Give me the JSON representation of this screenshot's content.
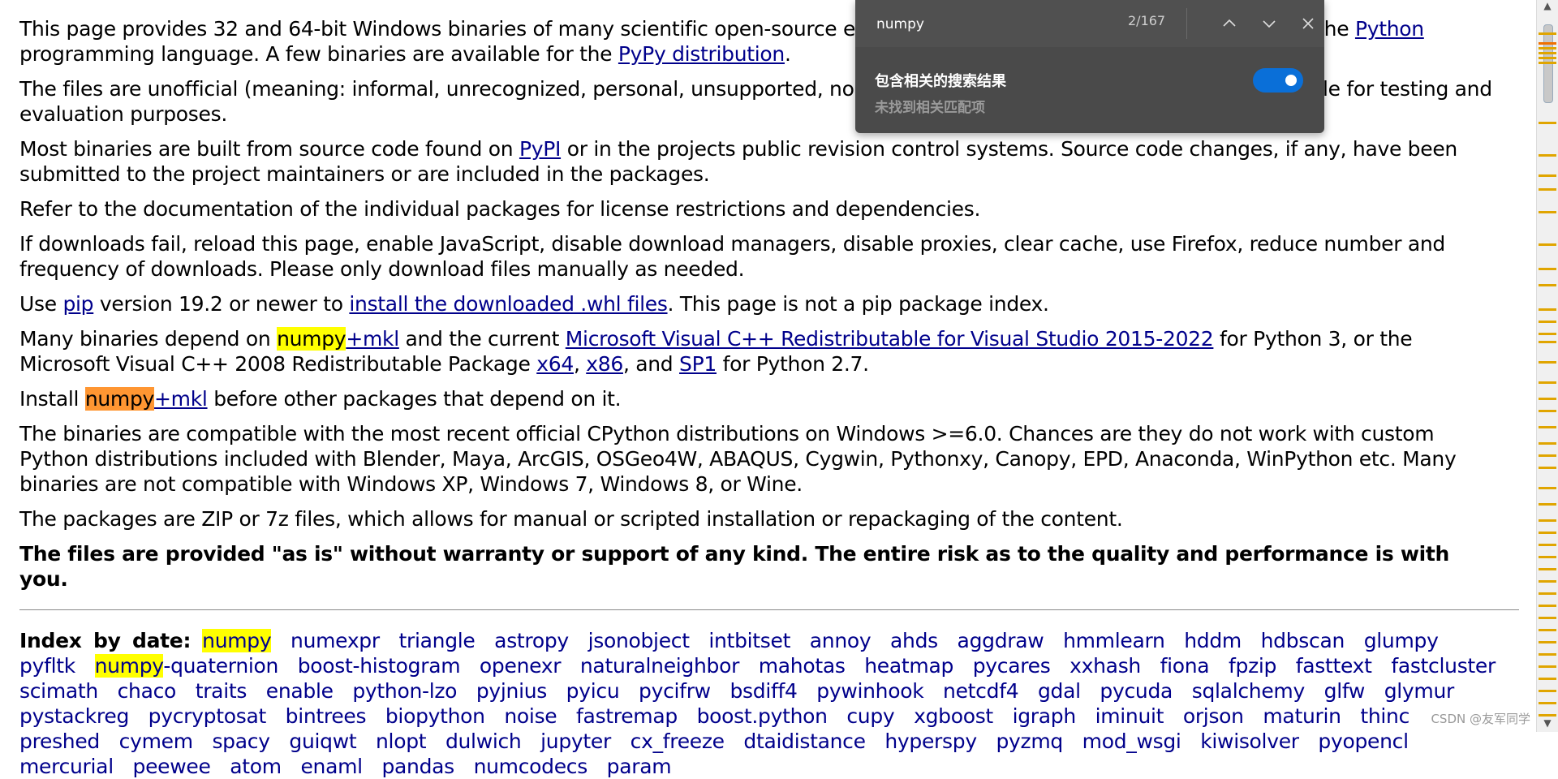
{
  "paragraphs": {
    "p1": {
      "t1": "This page provides 32 and 64-bit Windows binaries of many scientific open-source extens",
      "t2": "of the ",
      "link_python": "Python",
      "t3": " programming language. A few binaries are available for the ",
      "link_pypy": "PyPy distribution",
      "t4": "."
    },
    "p2": {
      "t1": "The files are unofficial (meaning: informal, unrecognized, personal, unsupported, no warra",
      "t2": "le for testing and evaluation purposes."
    },
    "p3": {
      "t1": "Most binaries are built from source code found on ",
      "link_pypi": "PyPI",
      "t2": " or in the projects public revision control systems. Source code changes, if any, have been submitted to the project maintainers or are included in the packages."
    },
    "p4": "Refer to the documentation of the individual packages for license restrictions and dependencies.",
    "p5": "If downloads fail, reload this page, enable JavaScript, disable download managers, disable proxies, clear cache, use Firefox, reduce number and frequency of downloads. Please only download files manually as needed.",
    "p6": {
      "t1": "Use ",
      "link_pip": "pip",
      "t2": " version 19.2 or newer to ",
      "link_install": "install the downloaded .whl files",
      "t3": ". This page is not a pip package index."
    },
    "p7": {
      "t1": "Many binaries depend on ",
      "hl": "numpy",
      "link_mkl": "+mkl",
      "t2": " and the current ",
      "link_msvc": "Microsoft Visual C++ Redistributable for Visual Studio 2015-2022",
      "t3": " for Python 3, or the Microsoft Visual C++ 2008 Redistributable Package ",
      "link_x64": "x64",
      "c1": ", ",
      "link_x86": "x86",
      "t4": ", and ",
      "link_sp1": "SP1",
      "t5": " for Python 2.7."
    },
    "p8": {
      "t1": "Install ",
      "hl": "numpy",
      "link_mkl": "+mkl",
      "t2": " before other packages that depend on it."
    },
    "p9": "The binaries are compatible with the most recent official CPython distributions on Windows >=6.0. Chances are they do not work with custom Python distributions included with Blender, Maya, ArcGIS, OSGeo4W, ABAQUS, Cygwin, Pythonxy, Canopy, EPD, Anaconda, WinPython etc. Many binaries are not compatible with Windows XP, Windows 7, Windows 8, or Wine.",
    "p10": "The packages are ZIP or 7z files, which allows for manual or scripted installation or repackaging of the content.",
    "p11": "The files are provided \"as is\" without warranty or support of any kind. The entire risk as to the quality and performance is with you."
  },
  "index": {
    "label": "Index by date:",
    "items": [
      "numpy",
      "numexpr",
      "triangle",
      "astropy",
      "jsonobject",
      "intbitset",
      "annoy",
      "ahds",
      "aggdraw",
      "hmmlearn",
      "hddm",
      "hdbscan",
      "glumpy",
      "pyfltk",
      "numpy-quaternion",
      "boost-histogram",
      "openexr",
      "naturalneighbor",
      "mahotas",
      "heatmap",
      "pycares",
      "xxhash",
      "fiona",
      "fpzip",
      "fasttext",
      "fastcluster",
      "scimath",
      "chaco",
      "traits",
      "enable",
      "python-lzo",
      "pyjnius",
      "pyicu",
      "pycifrw",
      "bsdiff4",
      "pywinhook",
      "netcdf4",
      "gdal",
      "pycuda",
      "sqlalchemy",
      "glfw",
      "glymur",
      "pystackreg",
      "pycryptosat",
      "bintrees",
      "biopython",
      "noise",
      "fastremap",
      "boost.python",
      "cupy",
      "xgboost",
      "igraph",
      "iminuit",
      "orjson",
      "maturin",
      "thinc",
      "preshed",
      "cymem",
      "spacy",
      "guiqwt",
      "nlopt",
      "dulwich",
      "jupyter",
      "cx_freeze",
      "dtaidistance",
      "hyperspy",
      "pyzmq",
      "mod_wsgi",
      "kiwisolver",
      "pyopencl",
      "mercurial",
      "peewee",
      "atom",
      "enaml",
      "pandas",
      "numcodecs",
      "param"
    ]
  },
  "findbar": {
    "query": "numpy",
    "count": "2/167",
    "option_title": "包含相关的搜索结果",
    "option_sub": "未找到相关匹配项",
    "toggle_on": true
  },
  "watermark": "CSDN @友军同学",
  "colors": {
    "highlight": "#ffff00",
    "active_highlight": "#ff9632",
    "link": "#00008b",
    "toggle": "#0a6fd8"
  }
}
